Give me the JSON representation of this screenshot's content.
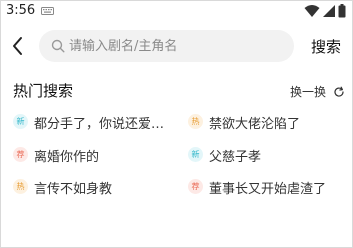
{
  "status_bar": {
    "time": "3:56",
    "icons": [
      "keyboard-icon",
      "wifi-icon",
      "signal-icon",
      "battery-icon"
    ]
  },
  "header": {
    "search_placeholder": "请输入剧名/主角名",
    "search_value": "",
    "search_button": "搜索"
  },
  "hot_search": {
    "title": "热门搜索",
    "refresh_label": "换一换",
    "items": [
      {
        "badge": "新",
        "type": "new",
        "label": "都分手了，你说还爱…"
      },
      {
        "badge": "热",
        "type": "hot",
        "label": "禁欲大佬沦陷了"
      },
      {
        "badge": "荐",
        "type": "rec",
        "label": "离婚你作的"
      },
      {
        "badge": "新",
        "type": "new",
        "label": "父慈子孝"
      },
      {
        "badge": "热",
        "type": "hot",
        "label": "言传不如身教"
      },
      {
        "badge": "荐",
        "type": "rec",
        "label": "董事长又开始虐渣了"
      }
    ]
  },
  "colors": {
    "new_badge": "#2fb6c9",
    "hot_badge": "#e79c32",
    "rec_badge": "#ea6b57",
    "search_box_bg": "#f2f2f2"
  }
}
